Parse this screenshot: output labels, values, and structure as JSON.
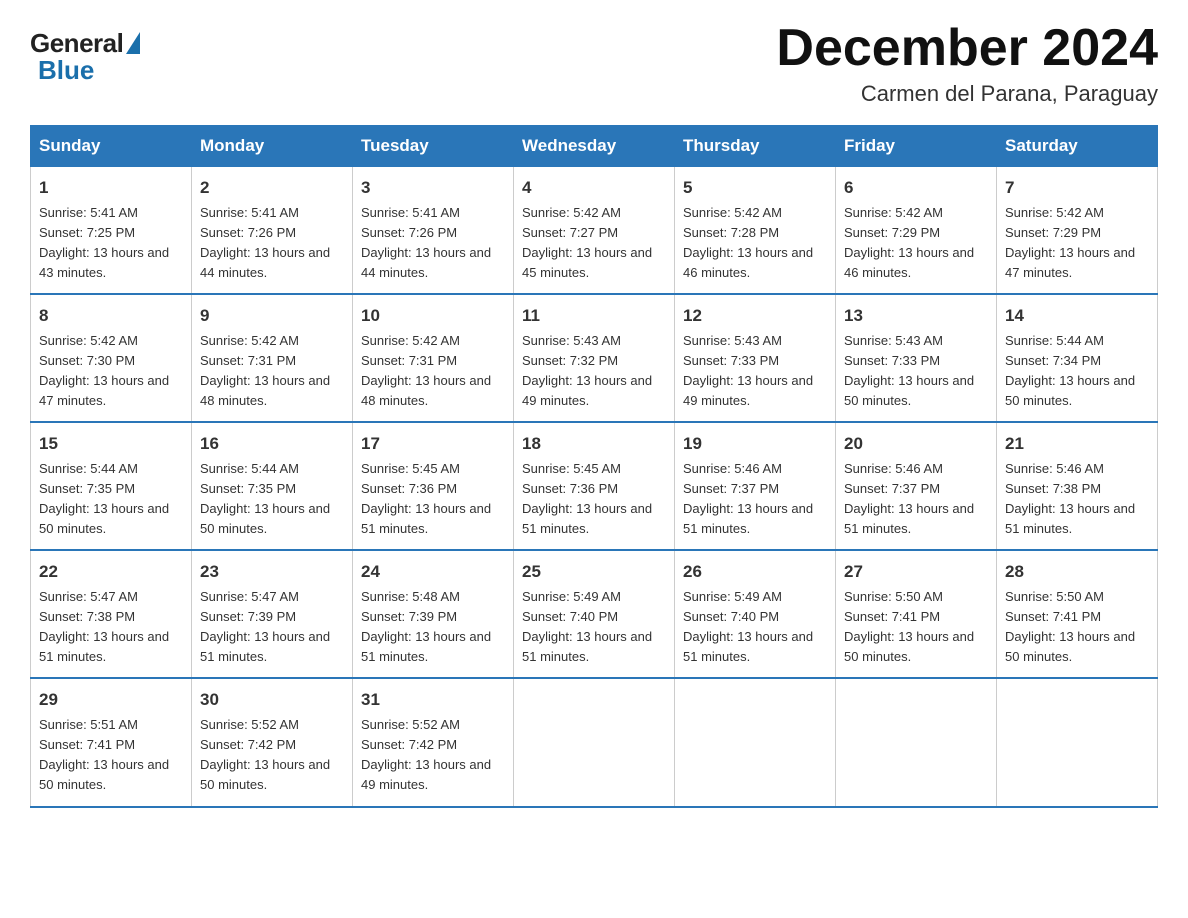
{
  "logo": {
    "general": "General",
    "blue": "Blue"
  },
  "title": {
    "month": "December 2024",
    "location": "Carmen del Parana, Paraguay"
  },
  "header": {
    "days": [
      "Sunday",
      "Monday",
      "Tuesday",
      "Wednesday",
      "Thursday",
      "Friday",
      "Saturday"
    ]
  },
  "weeks": [
    [
      {
        "day": "1",
        "sunrise": "5:41 AM",
        "sunset": "7:25 PM",
        "daylight": "13 hours and 43 minutes."
      },
      {
        "day": "2",
        "sunrise": "5:41 AM",
        "sunset": "7:26 PM",
        "daylight": "13 hours and 44 minutes."
      },
      {
        "day": "3",
        "sunrise": "5:41 AM",
        "sunset": "7:26 PM",
        "daylight": "13 hours and 44 minutes."
      },
      {
        "day": "4",
        "sunrise": "5:42 AM",
        "sunset": "7:27 PM",
        "daylight": "13 hours and 45 minutes."
      },
      {
        "day": "5",
        "sunrise": "5:42 AM",
        "sunset": "7:28 PM",
        "daylight": "13 hours and 46 minutes."
      },
      {
        "day": "6",
        "sunrise": "5:42 AM",
        "sunset": "7:29 PM",
        "daylight": "13 hours and 46 minutes."
      },
      {
        "day": "7",
        "sunrise": "5:42 AM",
        "sunset": "7:29 PM",
        "daylight": "13 hours and 47 minutes."
      }
    ],
    [
      {
        "day": "8",
        "sunrise": "5:42 AM",
        "sunset": "7:30 PM",
        "daylight": "13 hours and 47 minutes."
      },
      {
        "day": "9",
        "sunrise": "5:42 AM",
        "sunset": "7:31 PM",
        "daylight": "13 hours and 48 minutes."
      },
      {
        "day": "10",
        "sunrise": "5:42 AM",
        "sunset": "7:31 PM",
        "daylight": "13 hours and 48 minutes."
      },
      {
        "day": "11",
        "sunrise": "5:43 AM",
        "sunset": "7:32 PM",
        "daylight": "13 hours and 49 minutes."
      },
      {
        "day": "12",
        "sunrise": "5:43 AM",
        "sunset": "7:33 PM",
        "daylight": "13 hours and 49 minutes."
      },
      {
        "day": "13",
        "sunrise": "5:43 AM",
        "sunset": "7:33 PM",
        "daylight": "13 hours and 50 minutes."
      },
      {
        "day": "14",
        "sunrise": "5:44 AM",
        "sunset": "7:34 PM",
        "daylight": "13 hours and 50 minutes."
      }
    ],
    [
      {
        "day": "15",
        "sunrise": "5:44 AM",
        "sunset": "7:35 PM",
        "daylight": "13 hours and 50 minutes."
      },
      {
        "day": "16",
        "sunrise": "5:44 AM",
        "sunset": "7:35 PM",
        "daylight": "13 hours and 50 minutes."
      },
      {
        "day": "17",
        "sunrise": "5:45 AM",
        "sunset": "7:36 PM",
        "daylight": "13 hours and 51 minutes."
      },
      {
        "day": "18",
        "sunrise": "5:45 AM",
        "sunset": "7:36 PM",
        "daylight": "13 hours and 51 minutes."
      },
      {
        "day": "19",
        "sunrise": "5:46 AM",
        "sunset": "7:37 PM",
        "daylight": "13 hours and 51 minutes."
      },
      {
        "day": "20",
        "sunrise": "5:46 AM",
        "sunset": "7:37 PM",
        "daylight": "13 hours and 51 minutes."
      },
      {
        "day": "21",
        "sunrise": "5:46 AM",
        "sunset": "7:38 PM",
        "daylight": "13 hours and 51 minutes."
      }
    ],
    [
      {
        "day": "22",
        "sunrise": "5:47 AM",
        "sunset": "7:38 PM",
        "daylight": "13 hours and 51 minutes."
      },
      {
        "day": "23",
        "sunrise": "5:47 AM",
        "sunset": "7:39 PM",
        "daylight": "13 hours and 51 minutes."
      },
      {
        "day": "24",
        "sunrise": "5:48 AM",
        "sunset": "7:39 PM",
        "daylight": "13 hours and 51 minutes."
      },
      {
        "day": "25",
        "sunrise": "5:49 AM",
        "sunset": "7:40 PM",
        "daylight": "13 hours and 51 minutes."
      },
      {
        "day": "26",
        "sunrise": "5:49 AM",
        "sunset": "7:40 PM",
        "daylight": "13 hours and 51 minutes."
      },
      {
        "day": "27",
        "sunrise": "5:50 AM",
        "sunset": "7:41 PM",
        "daylight": "13 hours and 50 minutes."
      },
      {
        "day": "28",
        "sunrise": "5:50 AM",
        "sunset": "7:41 PM",
        "daylight": "13 hours and 50 minutes."
      }
    ],
    [
      {
        "day": "29",
        "sunrise": "5:51 AM",
        "sunset": "7:41 PM",
        "daylight": "13 hours and 50 minutes."
      },
      {
        "day": "30",
        "sunrise": "5:52 AM",
        "sunset": "7:42 PM",
        "daylight": "13 hours and 50 minutes."
      },
      {
        "day": "31",
        "sunrise": "5:52 AM",
        "sunset": "7:42 PM",
        "daylight": "13 hours and 49 minutes."
      },
      null,
      null,
      null,
      null
    ]
  ]
}
